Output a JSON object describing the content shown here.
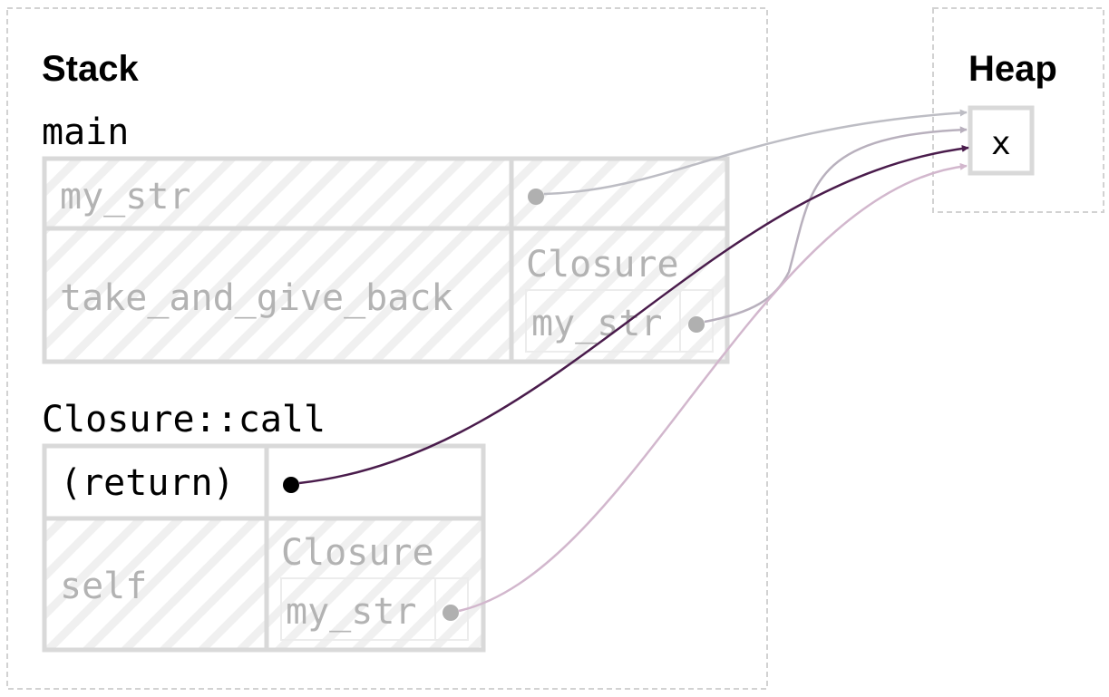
{
  "stack": {
    "title": "Stack",
    "frames": [
      {
        "name": "main",
        "rows": [
          {
            "variable": "my_str",
            "value": "pointer"
          },
          {
            "variable": "take_and_give_back",
            "value_type": "Closure",
            "field": "my_str"
          }
        ]
      },
      {
        "name": "Closure::call",
        "rows": [
          {
            "variable": "(return)",
            "value": "pointer"
          },
          {
            "variable": "self",
            "value_type": "Closure",
            "field": "my_str"
          }
        ]
      }
    ]
  },
  "heap": {
    "title": "Heap",
    "cell": "x"
  },
  "colors": {
    "arrow_main_my_str": "#bdbdc4",
    "arrow_main_closure": "#b8b0bd",
    "arrow_return": "#4a1c4c",
    "arrow_self": "#d2b7cd",
    "border": "#d9d9d9",
    "faded_text": "#b3b3b3"
  }
}
